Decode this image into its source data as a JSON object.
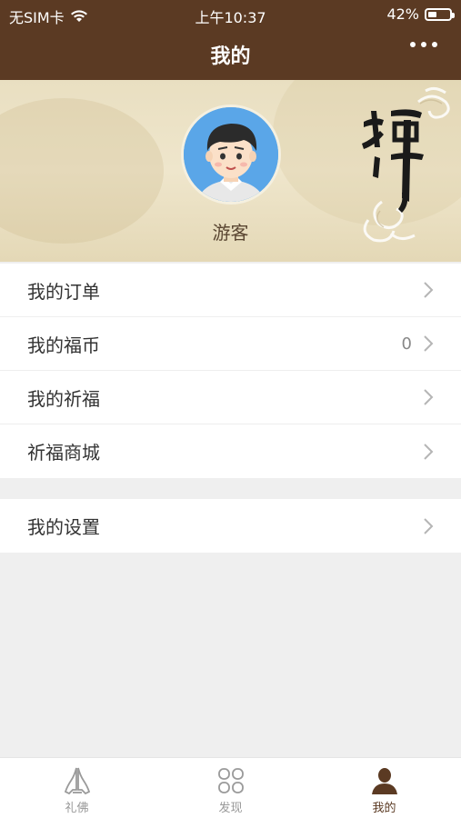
{
  "status_bar": {
    "carrier": "无SIM卡",
    "time": "上午10:37",
    "battery": "42%",
    "battery_level": 0.42
  },
  "navbar": {
    "title": "我的"
  },
  "profile": {
    "name": "游客"
  },
  "menu_primary": [
    {
      "label": "我的订单",
      "count": ""
    },
    {
      "label": "我的福币",
      "count": "0"
    },
    {
      "label": "我的祈福",
      "count": ""
    },
    {
      "label": "祈福商城",
      "count": ""
    }
  ],
  "menu_secondary": [
    {
      "label": "我的设置"
    }
  ],
  "tabbar": [
    {
      "label": "礼佛",
      "icon": "praying-hands-icon",
      "active": false
    },
    {
      "label": "发现",
      "icon": "discover-icon",
      "active": false
    },
    {
      "label": "我的",
      "icon": "user-icon",
      "active": true
    }
  ],
  "colors": {
    "brand": "#5b3a23",
    "background": "#efefef"
  }
}
